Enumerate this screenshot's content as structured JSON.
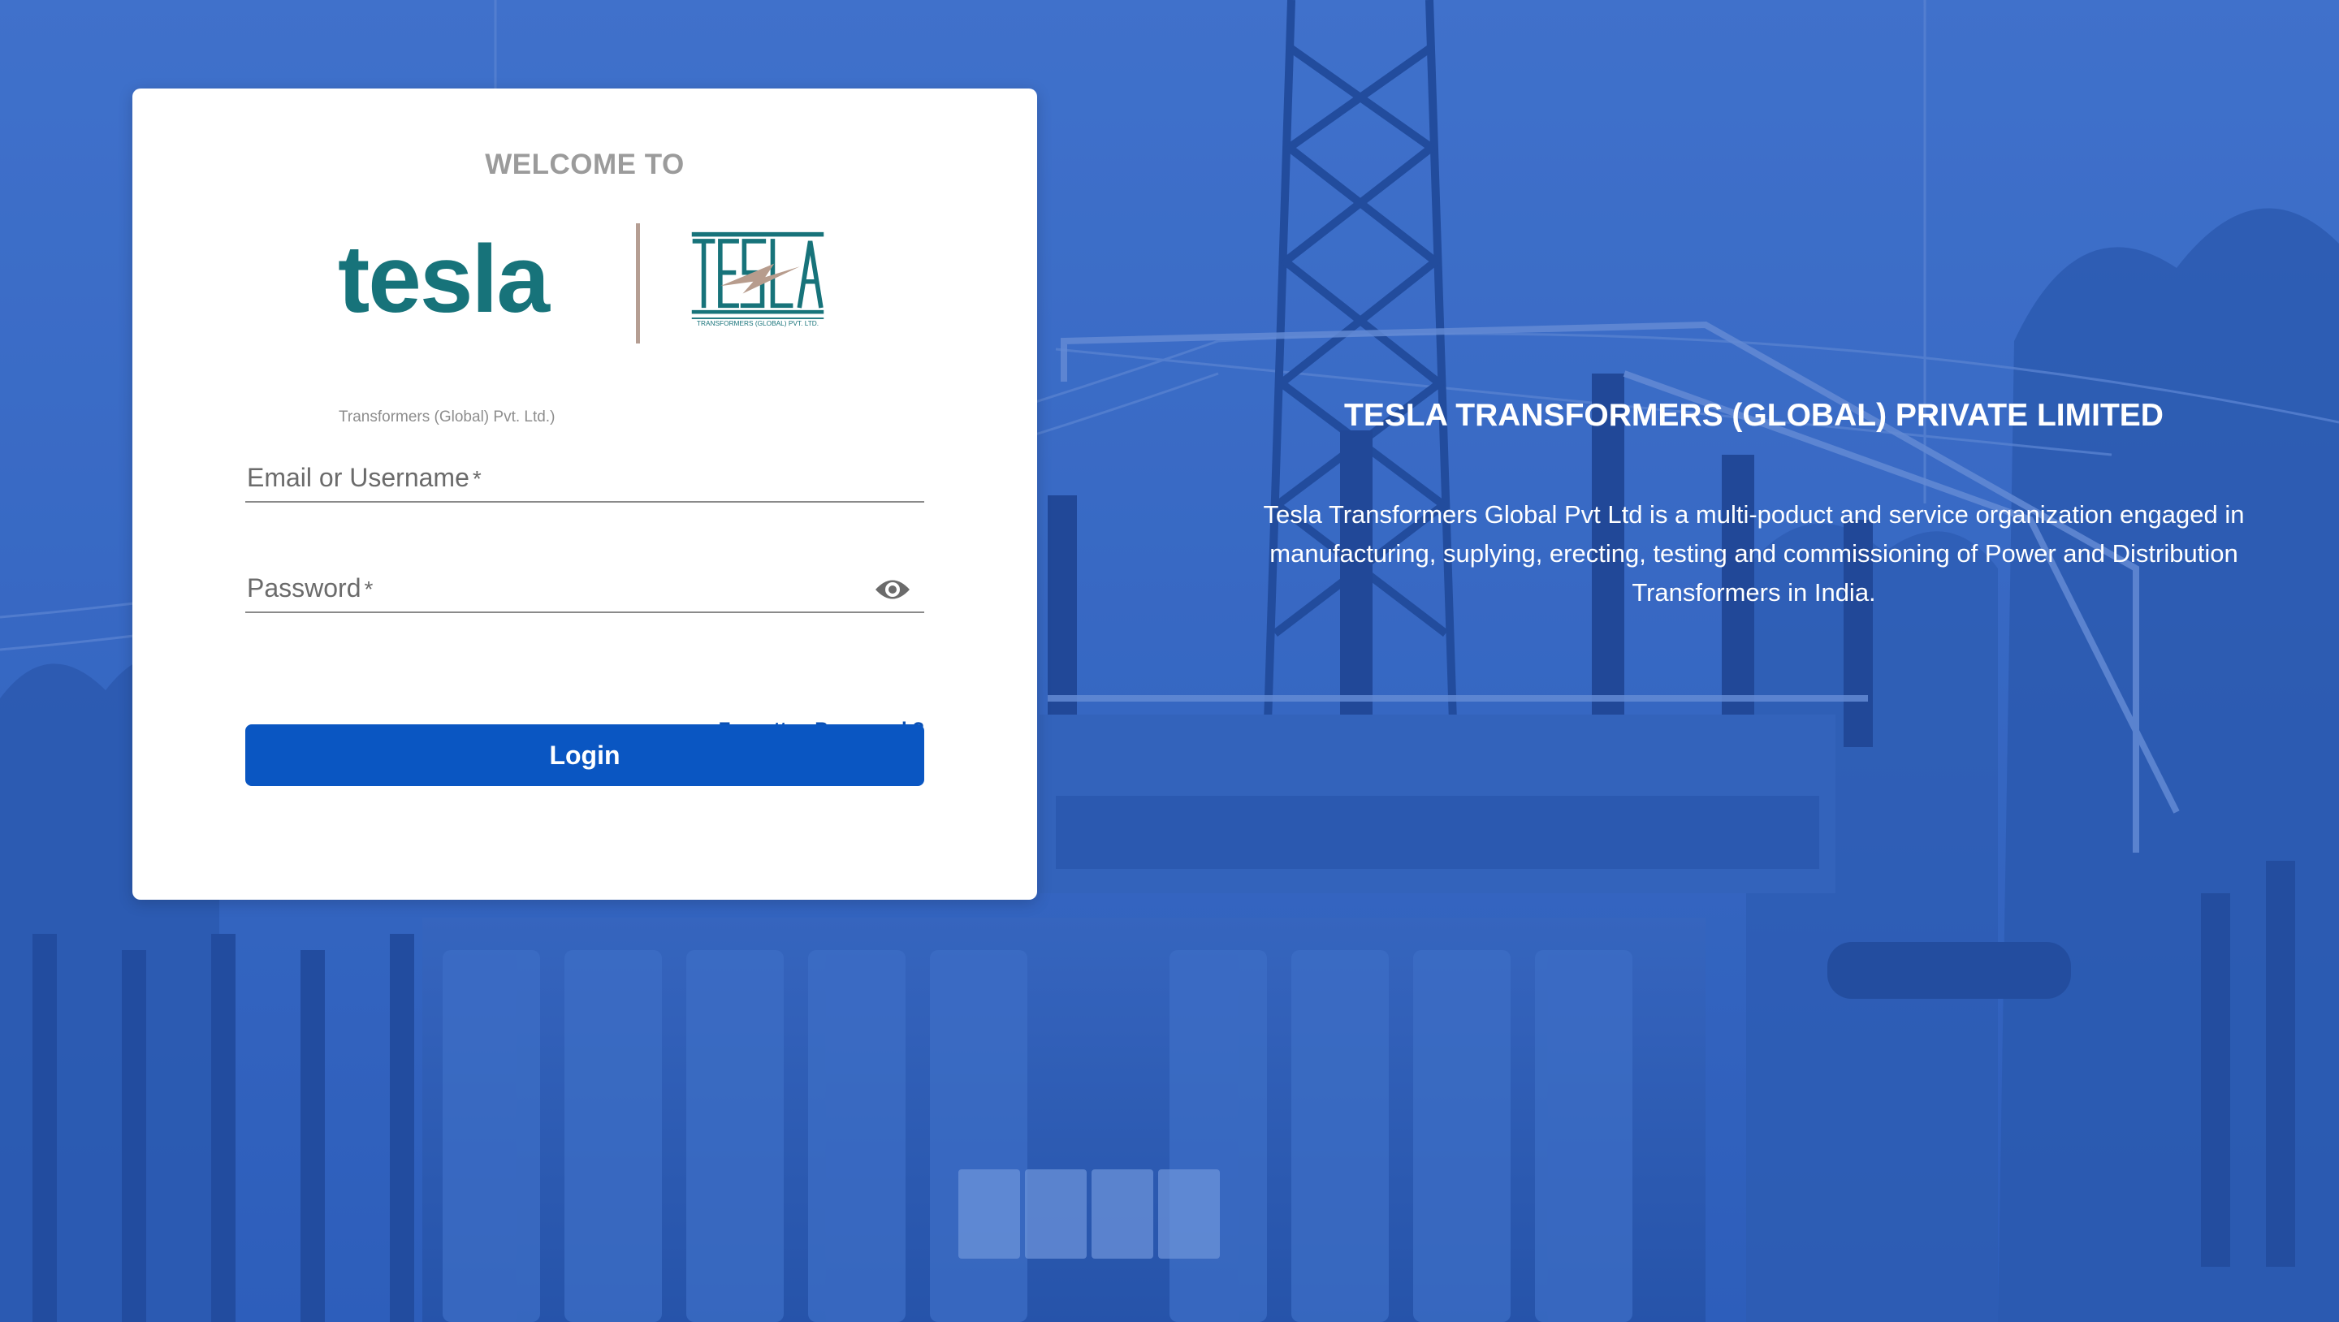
{
  "login_card": {
    "welcome": "WELCOME TO",
    "logo": {
      "wordmark": "tesla",
      "subtitle": "Transformers (Global) Pvt. Ltd.)",
      "mark_text": "TESLA",
      "mark_subtitle": "TRANSFORMERS (GLOBAL) PVT. LTD."
    },
    "email_field": {
      "label": "Email or Username",
      "required_mark": "*"
    },
    "password_field": {
      "label": "Password",
      "required_mark": "*"
    },
    "forgot_password": "Forgotten Password ?",
    "login_button": "Login"
  },
  "hero": {
    "title": "TESLA TRANSFORMERS (GLOBAL) PRIVATE LIMITED",
    "description": "Tesla Transformers Global Pvt Ltd is a multi-poduct and service organization engaged in manufacturing, suplying, erecting, testing and commissioning of Power and Distribution Transformers in India."
  },
  "colors": {
    "background_blue": "#3f70c4",
    "brand_teal": "#17737a",
    "button_blue": "#0a56c2",
    "link_blue": "#0a4fb3",
    "divider_tan": "#b59e93"
  },
  "icons": {
    "password_toggle": "eye-icon"
  }
}
